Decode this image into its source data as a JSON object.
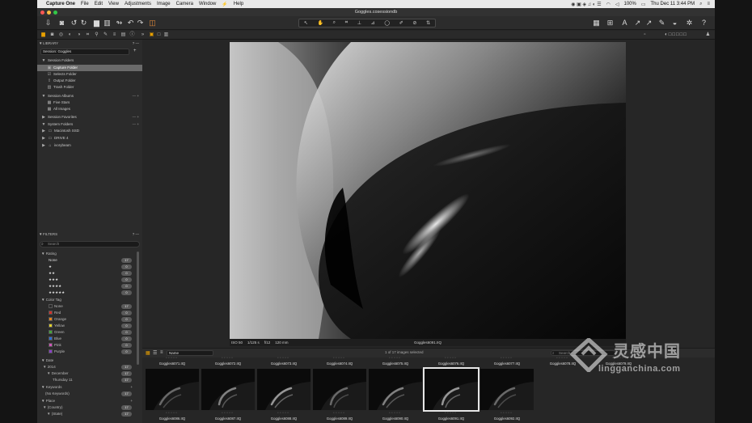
{
  "colors": {
    "accent": "#e8a000",
    "selection": "#6a6a6a",
    "traffic": [
      "#fc5753",
      "#fdbc40",
      "#33c748"
    ]
  },
  "menubar": {
    "app": "Capture One",
    "items": [
      "File",
      "Edit",
      "View",
      "Adjustments",
      "Image",
      "Camera",
      "Window",
      "Help"
    ],
    "clock": "Thu Dec 11  3:44 PM",
    "battery": "100%"
  },
  "window": {
    "title": "Goggles.cosessiondb"
  },
  "sidebar": {
    "library_label": "LIBRARY",
    "session_select": "Session: Goggles",
    "session_folders": {
      "label": "Session Folders",
      "items": [
        "Capture Folder",
        "Selects Folder",
        "Output Folder",
        "Trash Folder"
      ]
    },
    "session_albums": {
      "label": "Session Albums",
      "items": [
        "Five Stars",
        "All Images"
      ]
    },
    "session_favorites": {
      "label": "Session Favorites"
    },
    "system_folders": {
      "label": "System Folders",
      "items": [
        "Macintosh SSD",
        "DRIVE 4",
        "ivorybeam"
      ]
    },
    "filters_label": "FILTERS",
    "search_placeholder": "Search",
    "rating": {
      "label": "Rating",
      "items": [
        {
          "label": "None",
          "count": "17"
        },
        {
          "label": "★",
          "count": "0"
        },
        {
          "label": "★★",
          "count": "0"
        },
        {
          "label": "★★★",
          "count": "0"
        },
        {
          "label": "★★★★",
          "count": "0"
        },
        {
          "label": "★★★★★",
          "count": "0"
        }
      ]
    },
    "color_tag": {
      "label": "Color Tag",
      "items": [
        {
          "label": "None",
          "count": "17",
          "color": "#2a2a2a"
        },
        {
          "label": "Red",
          "count": "0",
          "color": "#d0302a"
        },
        {
          "label": "Orange",
          "count": "0",
          "color": "#e8841c"
        },
        {
          "label": "Yellow",
          "count": "0",
          "color": "#e2d12a"
        },
        {
          "label": "Green",
          "count": "0",
          "color": "#45a63a"
        },
        {
          "label": "Blue",
          "count": "0",
          "color": "#2f6fd6"
        },
        {
          "label": "Pink",
          "count": "0",
          "color": "#d056b8"
        },
        {
          "label": "Purple",
          "count": "0",
          "color": "#8a3fc8"
        }
      ]
    },
    "date": {
      "label": "Date",
      "items": [
        {
          "label": "2014",
          "count": "17"
        },
        {
          "label": "December",
          "count": "17"
        },
        {
          "label": "Thursday 11",
          "count": "17"
        }
      ]
    },
    "keywords": {
      "label": "Keywords",
      "items": [
        {
          "label": "(No Keywords)",
          "count": "17"
        }
      ]
    },
    "place": {
      "label": "Place",
      "items": [
        {
          "label": "(Country)",
          "count": "17"
        },
        {
          "label": "(State)",
          "count": "17"
        }
      ]
    }
  },
  "viewer": {
    "iso": "ISO 50",
    "shutter": "1/125 s",
    "aperture": "f/12",
    "focal": "120 mm",
    "filename": "Goggles6091.IIQ"
  },
  "browser": {
    "sort": "Name",
    "count": "1 of 17 images selected",
    "search_placeholder": "Search",
    "top_labels": [
      "Goggles6071.IIQ",
      "Goggles6072.IIQ",
      "Goggles6073.IIQ",
      "Goggles6074.IIQ",
      "Goggles6075.IIQ",
      "Goggles6076.IIQ",
      "Goggles6077.IIQ",
      "Goggles6078.IIQ",
      "Goggles6079.IIQ"
    ],
    "thumbs": [
      "Goggles6086.IIQ",
      "Goggles6087.IIQ",
      "Goggles6088.IIQ",
      "Goggles6089.IIQ",
      "Goggles6090.IIQ",
      "Goggles6091.IIQ",
      "Goggles6092.IIQ"
    ],
    "selected_index": 5
  },
  "watermark": {
    "cn": "灵感中国",
    "url": "lingganchina.com"
  }
}
